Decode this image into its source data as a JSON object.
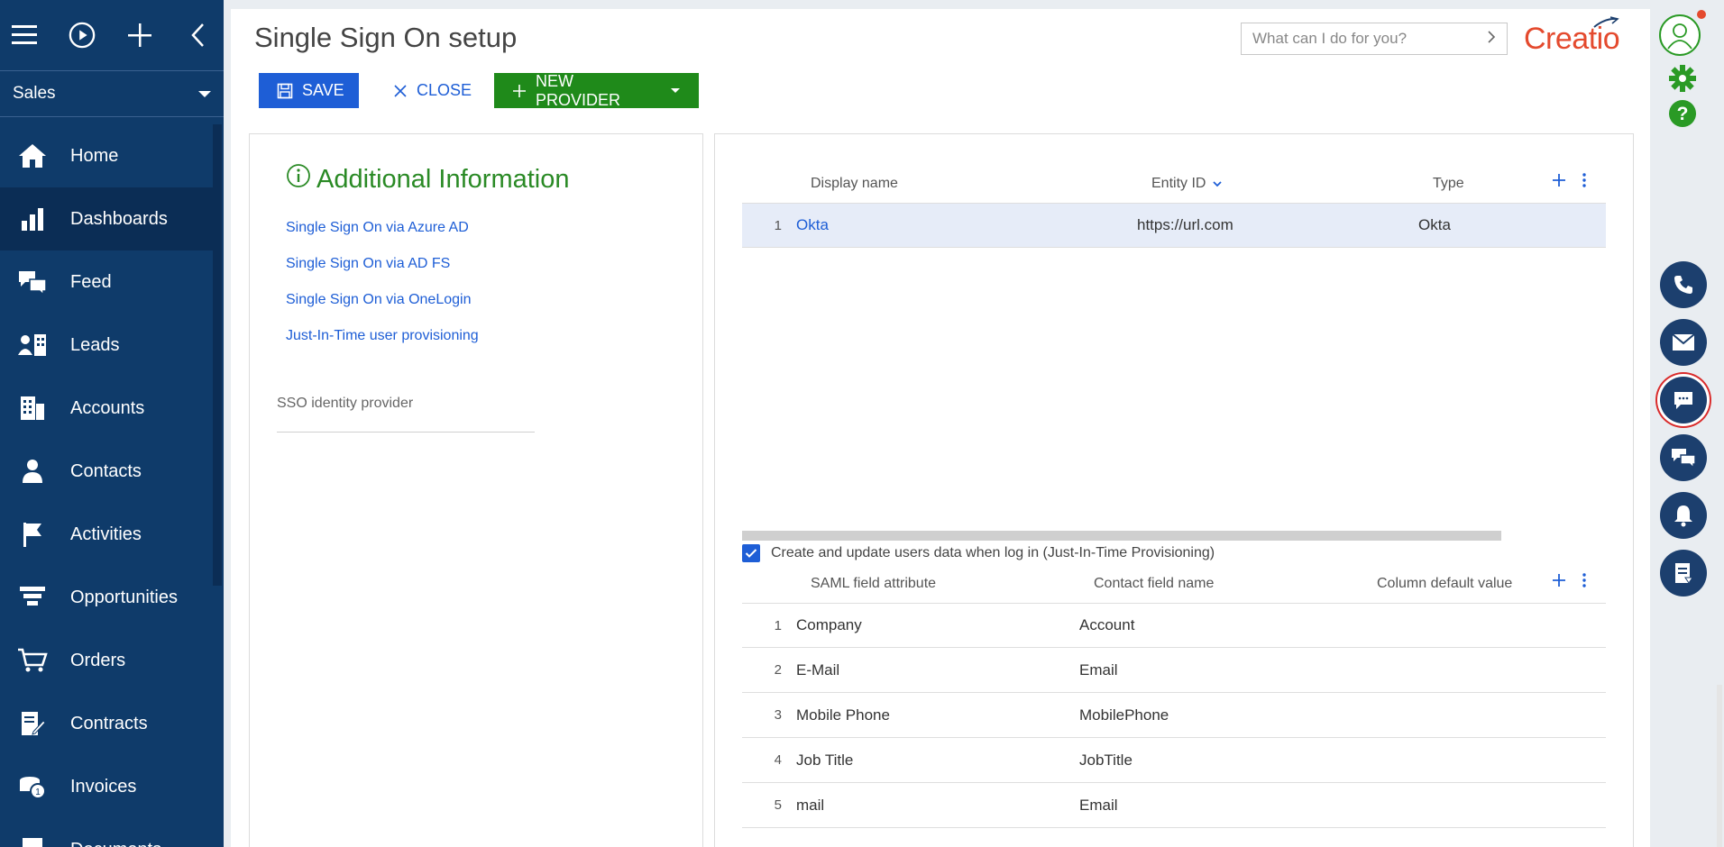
{
  "sidebar": {
    "workspace": "Sales",
    "items": [
      {
        "label": "Home",
        "icon": "home-icon"
      },
      {
        "label": "Dashboards",
        "icon": "bar-chart-icon"
      },
      {
        "label": "Feed",
        "icon": "chat-icon"
      },
      {
        "label": "Leads",
        "icon": "leads-icon"
      },
      {
        "label": "Accounts",
        "icon": "building-icon"
      },
      {
        "label": "Contacts",
        "icon": "person-icon"
      },
      {
        "label": "Activities",
        "icon": "flag-icon"
      },
      {
        "label": "Opportunities",
        "icon": "funnel-icon"
      },
      {
        "label": "Orders",
        "icon": "cart-icon"
      },
      {
        "label": "Contracts",
        "icon": "contract-icon"
      },
      {
        "label": "Invoices",
        "icon": "coins-icon"
      },
      {
        "label": "Documents",
        "icon": "document-icon"
      }
    ]
  },
  "header": {
    "title": "Single Sign On setup",
    "search_placeholder": "What can I do for you?",
    "logo": "Creatio"
  },
  "toolbar": {
    "save_label": "SAVE",
    "close_label": "CLOSE",
    "new_provider_label": "NEW PROVIDER"
  },
  "info": {
    "title": "Additional Information",
    "links": [
      "Single Sign On via Azure AD",
      "Single Sign On via AD FS",
      "Single Sign On via OneLogin",
      "Just-In-Time user provisioning"
    ],
    "sso_label": "SSO identity provider"
  },
  "providers": {
    "columns": [
      "Display name",
      "Entity ID",
      "Type"
    ],
    "rows": [
      {
        "num": "1",
        "name": "Okta",
        "entity_id": "https://url.com",
        "type": "Okta"
      }
    ]
  },
  "jit": {
    "checkbox_label": "Create and update users data when log in (Just-In-Time Provisioning)",
    "checked": true,
    "columns": [
      "SAML field attribute",
      "Contact field name",
      "Column default value"
    ],
    "rows": [
      {
        "num": "1",
        "saml": "Company",
        "contact": "Account"
      },
      {
        "num": "2",
        "saml": "E-Mail",
        "contact": "Email"
      },
      {
        "num": "3",
        "saml": "Mobile Phone",
        "contact": "MobilePhone"
      },
      {
        "num": "4",
        "saml": "Job Title",
        "contact": "JobTitle"
      },
      {
        "num": "5",
        "saml": "mail",
        "contact": "Email"
      }
    ]
  },
  "colors": {
    "sidebar_bg": "#0f3b6a",
    "accent_blue": "#1e5ed6",
    "green": "#1f8a1a",
    "brand": "#e44a2e"
  }
}
